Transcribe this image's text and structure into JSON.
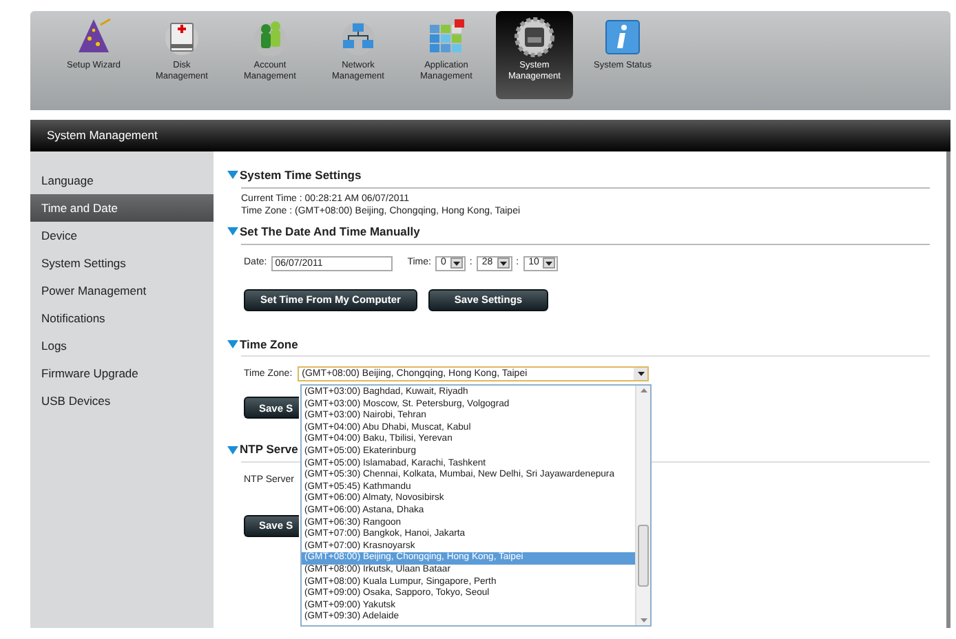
{
  "toolbar": {
    "items": [
      {
        "kind": "wizard",
        "lines": [
          "Setup Wizard"
        ],
        "selected": false
      },
      {
        "kind": "disk",
        "lines": [
          "Disk",
          "Management"
        ],
        "selected": false
      },
      {
        "kind": "account",
        "lines": [
          "Account",
          "Management"
        ],
        "selected": false
      },
      {
        "kind": "network",
        "lines": [
          "Network",
          "Management"
        ],
        "selected": false
      },
      {
        "kind": "application",
        "lines": [
          "Application",
          "Management"
        ],
        "selected": false
      },
      {
        "kind": "system",
        "lines": [
          "System",
          "Management"
        ],
        "selected": true
      },
      {
        "kind": "status",
        "lines": [
          "System Status"
        ],
        "selected": false
      }
    ]
  },
  "header": {
    "title": "System Management"
  },
  "sidebar": {
    "items": [
      {
        "label": "Language",
        "selected": false
      },
      {
        "label": "Time and Date",
        "selected": true
      },
      {
        "label": "Device",
        "selected": false
      },
      {
        "label": "System Settings",
        "selected": false
      },
      {
        "label": "Power Management",
        "selected": false
      },
      {
        "label": "Notifications",
        "selected": false
      },
      {
        "label": "Logs",
        "selected": false
      },
      {
        "label": "Firmware Upgrade",
        "selected": false
      },
      {
        "label": "USB Devices",
        "selected": false
      }
    ]
  },
  "system_time": {
    "title": "System Time Settings",
    "current_time": "Current Time : 00:28:21 AM 06/07/2011",
    "time_zone": "Time Zone : (GMT+08:00) Beijing, Chongqing, Hong Kong, Taipei"
  },
  "manual": {
    "title": "Set The Date And Time Manually",
    "date_label": "Date:",
    "date_value": "06/07/2011",
    "time_label": "Time:",
    "hour": "0",
    "minute": "28",
    "second": "10",
    "separator_1": ":",
    "separator_2": ":",
    "buttons": [
      "Set Time From My Computer",
      "Save Settings"
    ]
  },
  "time_zone": {
    "title": "Time Zone",
    "label": "Time Zone:",
    "value": "(GMT+08:00) Beijing, Chongqing, Hong Kong, Taipei",
    "save_button": "Save S",
    "options": [
      {
        "label": "(GMT+03:00) Baghdad, Kuwait, Riyadh",
        "selected": false
      },
      {
        "label": "(GMT+03:00) Moscow, St. Petersburg, Volgograd",
        "selected": false
      },
      {
        "label": "(GMT+03:00) Nairobi, Tehran",
        "selected": false
      },
      {
        "label": "(GMT+04:00) Abu Dhabi, Muscat, Kabul",
        "selected": false
      },
      {
        "label": "(GMT+04:00) Baku, Tbilisi, Yerevan",
        "selected": false
      },
      {
        "label": "(GMT+05:00) Ekaterinburg",
        "selected": false
      },
      {
        "label": "(GMT+05:00) Islamabad, Karachi, Tashkent",
        "selected": false
      },
      {
        "label": "(GMT+05:30) Chennai, Kolkata, Mumbai, New Delhi, Sri Jayawardenepura",
        "selected": false
      },
      {
        "label": "(GMT+05:45) Kathmandu",
        "selected": false
      },
      {
        "label": "(GMT+06:00) Almaty, Novosibirsk",
        "selected": false
      },
      {
        "label": "(GMT+06:00) Astana, Dhaka",
        "selected": false
      },
      {
        "label": "(GMT+06:30) Rangoon",
        "selected": false
      },
      {
        "label": "(GMT+07:00) Bangkok, Hanoi, Jakarta",
        "selected": false
      },
      {
        "label": "(GMT+07:00) Krasnoyarsk",
        "selected": false
      },
      {
        "label": "(GMT+08:00) Beijing, Chongqing, Hong Kong, Taipei",
        "selected": true
      },
      {
        "label": "(GMT+08:00) Irkutsk, Ulaan Bataar",
        "selected": false
      },
      {
        "label": "(GMT+08:00) Kuala Lumpur, Singapore, Perth",
        "selected": false
      },
      {
        "label": "(GMT+09:00) Osaka, Sapporo, Tokyo, Seoul",
        "selected": false
      },
      {
        "label": "(GMT+09:00) Yakutsk",
        "selected": false
      },
      {
        "label": "(GMT+09:30) Adelaide",
        "selected": false
      }
    ]
  },
  "ntp": {
    "title": "NTP Serve",
    "label": "NTP Server",
    "save_button": "Save S"
  }
}
